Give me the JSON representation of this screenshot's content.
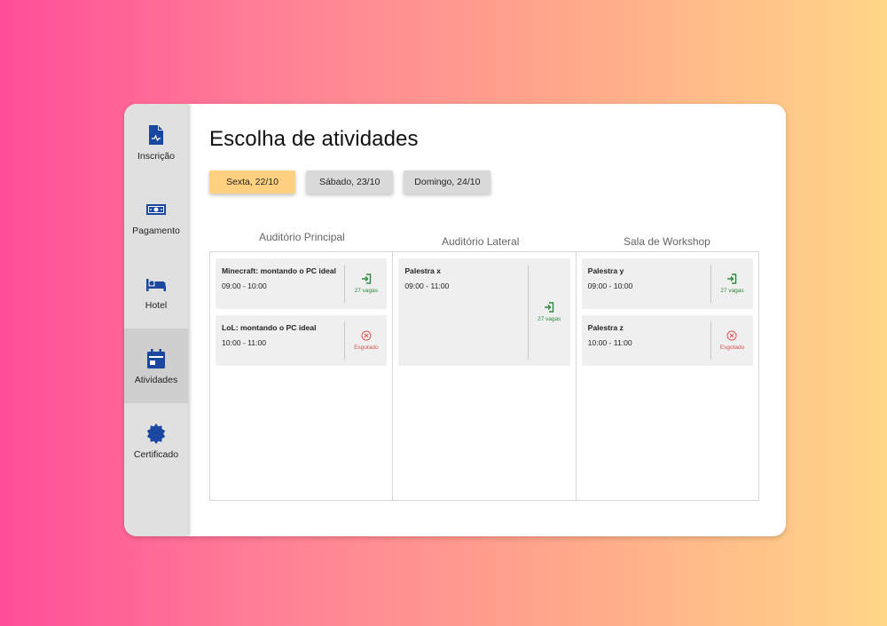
{
  "sidebar": {
    "items": [
      {
        "label": "Inscrição",
        "icon": "document-icon"
      },
      {
        "label": "Pagamento",
        "icon": "money-icon"
      },
      {
        "label": "Hotel",
        "icon": "bed-icon"
      },
      {
        "label": "Atividades",
        "icon": "calendar-icon",
        "active": true
      },
      {
        "label": "Certificado",
        "icon": "badge-icon"
      }
    ]
  },
  "main": {
    "title": "Escolha de atividades",
    "tabs": [
      {
        "label": "Sexta, 22/10",
        "active": true
      },
      {
        "label": "Sábado, 23/10"
      },
      {
        "label": "Domingo, 24/10"
      }
    ],
    "rooms": [
      {
        "name": "Auditório Principal",
        "activities": [
          {
            "title": "Minecraft: montando o PC ideal",
            "time": "09:00 - 10:00",
            "status": "27 vagas",
            "available": true
          },
          {
            "title": "LoL: montando o PC ideal",
            "time": "10:00 - 11:00",
            "status": "Esgotado",
            "available": false
          }
        ]
      },
      {
        "name": "Auditório Lateral",
        "activities": [
          {
            "title": "Palestra x",
            "time": "09:00 - 11:00",
            "status": "27 vagas",
            "available": true
          }
        ]
      },
      {
        "name": "Sala de Workshop",
        "activities": [
          {
            "title": "Palestra y",
            "time": "09:00 - 10:00",
            "status": "27 vagas",
            "available": true
          },
          {
            "title": "Palestra z",
            "time": "10:00 - 11:00",
            "status": "Esgotado",
            "available": false
          }
        ]
      }
    ]
  },
  "colors": {
    "icon_blue": "#1a47a0",
    "active_tab": "#ffd180",
    "available": "#2e8b3c",
    "sold_out": "#d9534f"
  }
}
